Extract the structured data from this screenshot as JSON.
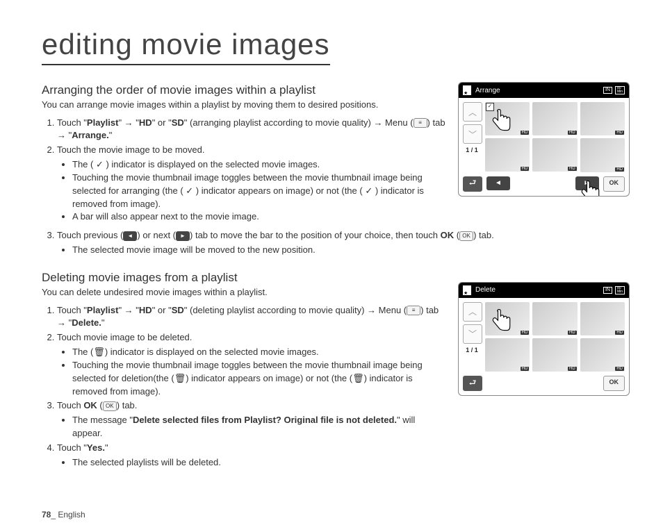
{
  "title": "editing movie images",
  "sectionA": {
    "heading": "Arranging the order of movie images within a playlist",
    "intro": "You can arrange movie images within a playlist by moving them to desired positions.",
    "step1_a": "Touch \"",
    "step1_b": "Playlist",
    "step1_c": "\" → \"",
    "step1_d": "HD",
    "step1_e": "\" or \"",
    "step1_f": "SD",
    "step1_g": "\" (arranging playlist according to movie quality) → Menu (",
    "step1_h": ") tab → \"",
    "step1_i": "Arrange.",
    "step1_j": "\"",
    "step2": "Touch the movie image to be moved.",
    "b1": "The ( ✓ ) indicator is displayed on the selected movie images.",
    "b2": "Touching the movie thumbnail image toggles between the movie thumbnail image being selected for arranging (the ( ✓ ) indicator appears on image) or not (the ( ✓ ) indicator is removed from image).",
    "b3": "A bar will also appear next to the movie image.",
    "step3_a": "Touch previous (",
    "step3_b": ") or next (",
    "step3_c": ") tab to move the bar to the position of your choice, then touch ",
    "step3_d": "OK",
    "step3_e": " (",
    "step3_f": ") tab.",
    "b4": "The selected movie image will be moved to the new position."
  },
  "sectionB": {
    "heading": "Deleting movie images from a playlist",
    "intro": "You can delete undesired movie images within a playlist.",
    "step1_a": "Touch \"",
    "step1_b": "Playlist",
    "step1_c": "\" → \"",
    "step1_d": "HD",
    "step1_e": "\" or \"",
    "step1_f": "SD",
    "step1_g": "\" (deleting playlist according to movie quality) → Menu (",
    "step1_h": ") tab → \"",
    "step1_i": "Delete.",
    "step1_j": "\"",
    "step2": "Touch movie image to be deleted.",
    "b1": "The (🗑) indicator is displayed on the selected movie images.",
    "b2": "Touching the movie thumbnail image toggles between the movie thumbnail image being selected for deletion(the (🗑) indicator appears on image) or not (the (🗑) indicator is removed from image).",
    "step3_a": "Touch ",
    "step3_b": "OK",
    "step3_c": " (",
    "step3_d": ") tab.",
    "b3_a": "The message \"",
    "b3_b": "Delete selected files from Playlist? Original file is not deleted.",
    "b3_c": "\" will appear.",
    "step4_a": "Touch \"",
    "step4_b": "Yes.",
    "step4_c": "\"",
    "b4": "The selected playlists will be deleted."
  },
  "figA": {
    "title": "Arrange",
    "in": "IN",
    "min": "80\nMin",
    "page": "1 / 1",
    "ok": "OK",
    "hd": "HD"
  },
  "figB": {
    "title": "Delete",
    "in": "IN",
    "min": "80\nMin",
    "page": "1 / 1",
    "ok": "OK",
    "hd": "HD"
  },
  "inline": {
    "menu": "≡",
    "prev": "◄",
    "next": "►",
    "ok": "OK"
  },
  "footer": {
    "page": "78",
    "sep": "_ ",
    "lang": "English"
  }
}
